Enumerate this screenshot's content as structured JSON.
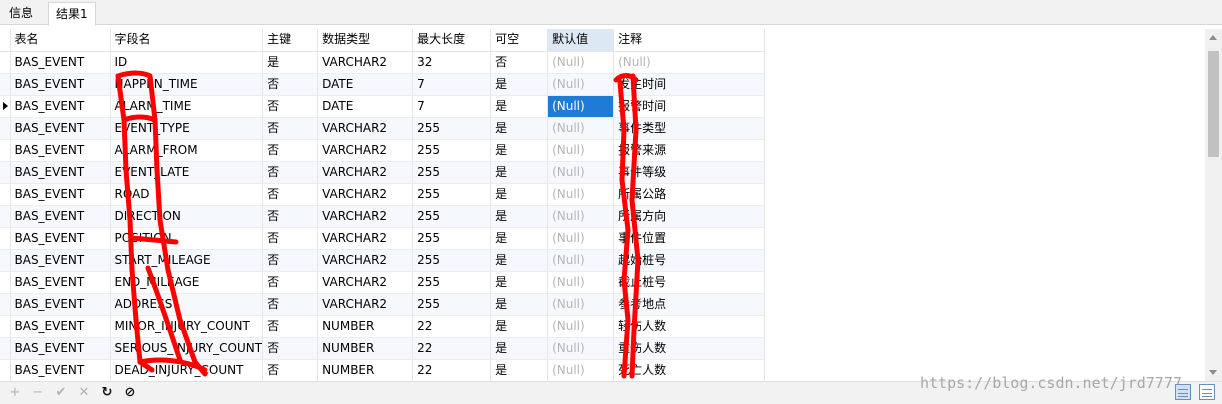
{
  "tabs": [
    {
      "label": "信息"
    },
    {
      "label": "结果1"
    }
  ],
  "columns": [
    "表名",
    "字段名",
    "主键",
    "数据类型",
    "最大长度",
    "可空",
    "默认值",
    "注释"
  ],
  "rows": [
    [
      "BAS_EVENT",
      "ID",
      "是",
      "VARCHAR2",
      "32",
      "否",
      "(Null)",
      "(Null)"
    ],
    [
      "BAS_EVENT",
      "HAPPEN_TIME",
      "否",
      "DATE",
      "7",
      "是",
      "(Null)",
      "发生时间"
    ],
    [
      "BAS_EVENT",
      "ALARM_TIME",
      "否",
      "DATE",
      "7",
      "是",
      "(Null)",
      "报警时间"
    ],
    [
      "BAS_EVENT",
      "EVENT_TYPE",
      "否",
      "VARCHAR2",
      "255",
      "是",
      "(Null)",
      "事件类型"
    ],
    [
      "BAS_EVENT",
      "ALARM_FROM",
      "否",
      "VARCHAR2",
      "255",
      "是",
      "(Null)",
      "报警来源"
    ],
    [
      "BAS_EVENT",
      "EVENT_LATE",
      "否",
      "VARCHAR2",
      "255",
      "是",
      "(Null)",
      "事件等级"
    ],
    [
      "BAS_EVENT",
      "ROAD",
      "否",
      "VARCHAR2",
      "255",
      "是",
      "(Null)",
      "所属公路"
    ],
    [
      "BAS_EVENT",
      "DIRECTION",
      "否",
      "VARCHAR2",
      "255",
      "是",
      "(Null)",
      "所属方向"
    ],
    [
      "BAS_EVENT",
      "POSITION",
      "否",
      "VARCHAR2",
      "255",
      "是",
      "(Null)",
      "事件位置"
    ],
    [
      "BAS_EVENT",
      "START_MILEAGE",
      "否",
      "VARCHAR2",
      "255",
      "是",
      "(Null)",
      "起始桩号"
    ],
    [
      "BAS_EVENT",
      "END_MILEAGE",
      "否",
      "VARCHAR2",
      "255",
      "是",
      "(Null)",
      "截止桩号"
    ],
    [
      "BAS_EVENT",
      "ADDRESS",
      "否",
      "VARCHAR2",
      "255",
      "是",
      "(Null)",
      "参考地点"
    ],
    [
      "BAS_EVENT",
      "MINOR_INJURY_COUNT",
      "否",
      "NUMBER",
      "22",
      "是",
      "(Null)",
      "轻伤人数"
    ],
    [
      "BAS_EVENT",
      "SERIOUS_INJURY_COUNT",
      "否",
      "NUMBER",
      "22",
      "是",
      "(Null)",
      "重伤人数"
    ],
    [
      "BAS_EVENT",
      "DEAD_INJURY_COUNT",
      "否",
      "NUMBER",
      "22",
      "是",
      "(Null)",
      "死亡人数"
    ]
  ],
  "null_text": "(Null)",
  "current_row_index": 2,
  "selected_cell": {
    "row": 2,
    "column": 6
  },
  "toolbar": {
    "buttons": [
      {
        "name": "add-record-icon",
        "glyph": "+"
      },
      {
        "name": "delete-record-icon",
        "glyph": "−"
      },
      {
        "name": "apply-changes-icon",
        "glyph": "✔"
      },
      {
        "name": "discard-changes-icon",
        "glyph": "✕"
      },
      {
        "name": "refresh-icon",
        "glyph": "↻"
      },
      {
        "name": "stop-icon",
        "glyph": "⊘"
      }
    ]
  },
  "watermark": "https://blog.csdn.net/jrd7777",
  "colors": {
    "selection": "#1e7bd6",
    "header_highlight": "#dde8f5",
    "null_text": "#b5b5b5",
    "scribble": "#ff0000"
  }
}
